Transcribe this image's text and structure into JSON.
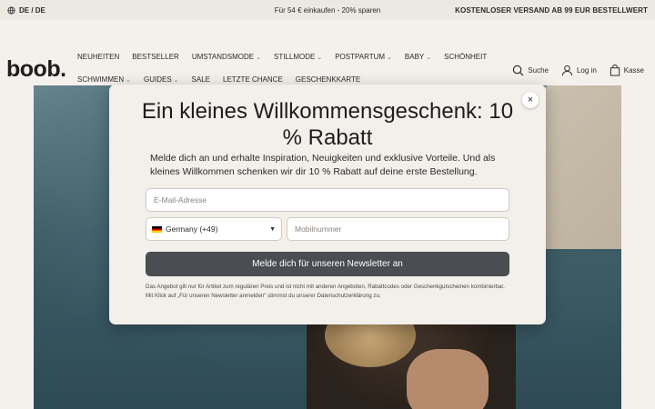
{
  "topbar": {
    "lang": "DE / DE",
    "promo": "Für 54 € einkaufen - 20% sparen",
    "shipping": "KOSTENLOSER VERSAND AB 99 EUR BESTELLWERT"
  },
  "header": {
    "logo": "boob.",
    "nav": [
      {
        "label": "NEUHEITEN",
        "dropdown": false
      },
      {
        "label": "BESTSELLER",
        "dropdown": false
      },
      {
        "label": "UMSTANDSMODE",
        "dropdown": true
      },
      {
        "label": "STILLMODE",
        "dropdown": true
      },
      {
        "label": "POSTPARTUM",
        "dropdown": true
      },
      {
        "label": "BABY",
        "dropdown": true
      },
      {
        "label": "SCHÖNHEIT",
        "dropdown": false
      },
      {
        "label": "SCHWIMMEN",
        "dropdown": true
      },
      {
        "label": "GUIDES",
        "dropdown": true
      },
      {
        "label": "SALE",
        "dropdown": false
      },
      {
        "label": "LETZTE CHANCE",
        "dropdown": false
      },
      {
        "label": "GESCHENKKARTE",
        "dropdown": false
      }
    ],
    "search_label": "Suche",
    "login_label": "Log in",
    "cart_label": "Kasse"
  },
  "modal": {
    "close": "×",
    "title": "Ein kleines Willkommensgeschenk: 10 % Rabatt",
    "description": "Melde dich an und erhalte Inspiration, Neuigkeiten und exklusive Vorteile. Und als kleines Willkommen schenken wir dir 10 % Rabatt auf deine erste Bestellung.",
    "email_placeholder": "E-Mail-Adresse",
    "country_value": "Germany (+49)",
    "phone_placeholder": "Mobilnummer",
    "submit_label": "Melde dich für unseren Newsletter an",
    "legal": "Das Angebot gilt nur für Artikel zum regulären Preis und ist nicht mit anderen Angeboten, Rabattcodes oder Geschenkgutscheinen kombinierbar. Mit Klick auf „Für unseren Newsletter anmelden“ stimmst du unserer Datenschutzerklärung zu."
  },
  "colors": {
    "accent_button": "#4a4d52",
    "page_bg": "#f4f1ec",
    "modal_bg": "#f3efea"
  },
  "icons": {
    "lang": "globe-icon",
    "search": "search-icon",
    "login": "user-icon",
    "cart": "bag-icon",
    "close": "close-icon",
    "country": "germany-flag-icon"
  }
}
